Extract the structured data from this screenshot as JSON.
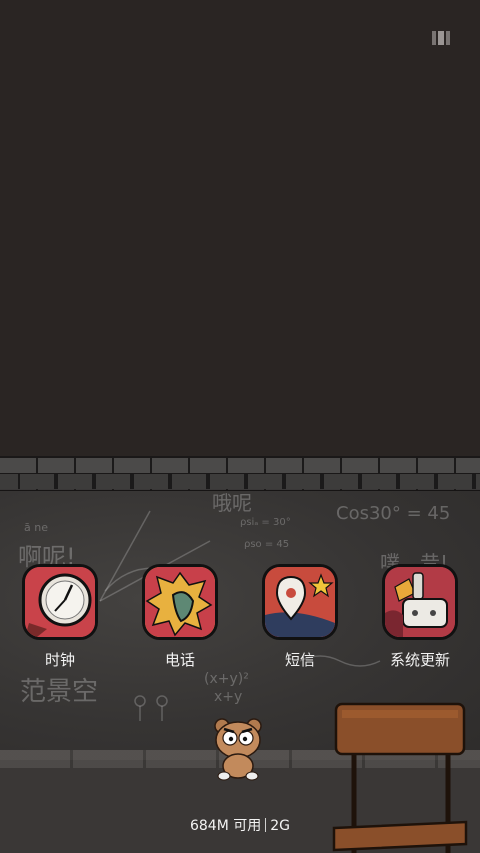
{
  "apps": [
    {
      "label": "时钟",
      "icon": "alarm-clock-icon"
    },
    {
      "label": "电话",
      "icon": "phone-icon"
    },
    {
      "label": "短信",
      "icon": "location-pin-message-icon"
    },
    {
      "label": "系统更新",
      "icon": "update-wrench-icon"
    }
  ],
  "status": {
    "memory": "684M 可用",
    "network": "2G"
  },
  "chalk_text": {
    "a_ne": "啊呢!",
    "oh_ne": "哦呢",
    "cos": "Cos30° = 45",
    "name": "范景空",
    "formula1": "ρsiₐ = 30°",
    "formula2": "ρso = 45",
    "formula3": "(x+y)²",
    "formula4": "x+y",
    "shout": "噗…昔!",
    "pinyin": "ā   ne"
  },
  "colors": {
    "wall_top": "#2a2523",
    "chalkboard": "#363433",
    "label": "#f2f2f2"
  }
}
